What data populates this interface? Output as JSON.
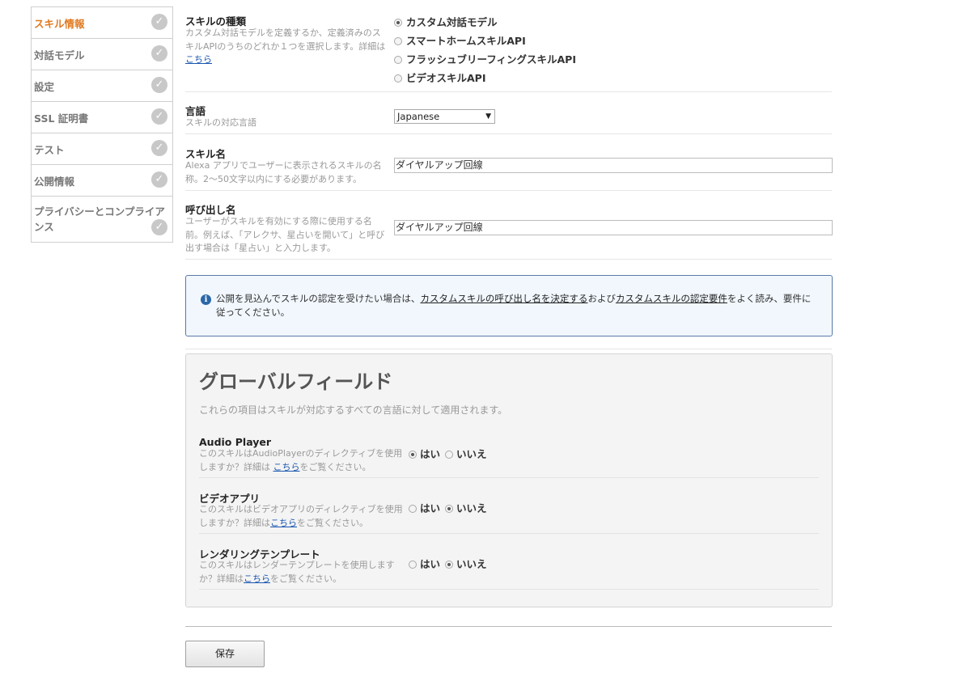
{
  "sidebar": {
    "items": [
      {
        "label": "スキル情報",
        "active": true
      },
      {
        "label": "対話モデル"
      },
      {
        "label": "設定"
      },
      {
        "label": "SSL 証明書"
      },
      {
        "label": "テスト"
      },
      {
        "label": "公開情報"
      },
      {
        "label": "プライバシーとコンプライアンス"
      }
    ]
  },
  "form": {
    "skill_type": {
      "label": "スキルの種類",
      "help_prefix": "カスタム対話モデルを定義するか、定義済みのスキルAPIのうちのどれか１つを選択します。詳細は",
      "help_link": "こちら",
      "options": [
        "カスタム対話モデル",
        "スマートホームスキルAPI",
        "フラッシュブリーフィングスキルAPI",
        "ビデオスキルAPI"
      ],
      "selected": "カスタム対話モデル"
    },
    "language": {
      "label": "言語",
      "help": "スキルの対応言語",
      "value": "Japanese"
    },
    "skill_name": {
      "label": "スキル名",
      "help": "Alexa アプリでユーザーに表示されるスキルの名称。2～50文字以内にする必要があります。",
      "value": "ダイヤルアップ回線"
    },
    "invocation_name": {
      "label": "呼び出し名",
      "help": "ユーザーがスキルを有効にする際に使用する名前。例えば、「アレクサ、星占いを開いて」と呼び出す場合は「星占い」と入力します。",
      "value": "ダイヤルアップ回線"
    }
  },
  "info": {
    "text_1": "公開を見込んでスキルの認定を受けたい場合は、",
    "link_1": "カスタムスキルの呼び出し名を決定する",
    "text_2": "および",
    "link_2": "カスタムスキルの認定要件",
    "text_3": "をよく読み、要件に従ってください。"
  },
  "global": {
    "title": "グローバルフィールド",
    "subtitle": "これらの項目はスキルが対応するすべての言語に対して適用されます。",
    "yes_label": "はい",
    "no_label": "いいえ",
    "fields": [
      {
        "label": "Audio Player",
        "help_prefix": "このスキルはAudioPlayerのディレクティブを使用しますか？詳細は ",
        "help_link": "こちら",
        "help_suffix": "をご覧ください。",
        "value": "はい"
      },
      {
        "label": "ビデオアプリ",
        "help_prefix": "このスキルはビデオアプリのディレクティブを使用しますか？詳細は",
        "help_link": "こちら",
        "help_suffix": "をご覧ください。",
        "value": "いいえ"
      },
      {
        "label": "レンダリングテンプレート",
        "help_prefix": "このスキルはレンダーテンプレートを使用しますか？詳細は",
        "help_link": "こちら",
        "help_suffix": "をご覧ください。",
        "value": "いいえ"
      }
    ]
  },
  "save_label": "保存",
  "icons": {
    "check": "check-circle-icon",
    "info": "info-icon"
  }
}
